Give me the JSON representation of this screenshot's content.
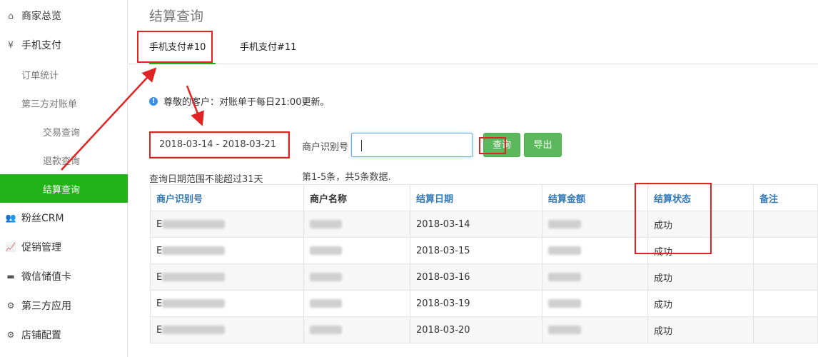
{
  "sidebar": {
    "items": [
      {
        "icon": "home-icon",
        "glyph": "⌂",
        "label": "商家总览"
      },
      {
        "icon": "yuan-icon",
        "glyph": "¥",
        "label": "手机支付"
      },
      {
        "label": "订单统计"
      },
      {
        "label": "第三方对账单"
      },
      {
        "label": "交易查询"
      },
      {
        "label": "退款查询"
      },
      {
        "label": "结算查询"
      },
      {
        "icon": "users-icon",
        "glyph": "👥",
        "label": "粉丝CRM"
      },
      {
        "icon": "chart-icon",
        "glyph": "📈",
        "label": "促销管理"
      },
      {
        "icon": "card-icon",
        "glyph": "▬",
        "label": "微信储值卡"
      },
      {
        "icon": "apps-icon",
        "glyph": "⚙",
        "label": "第三方应用"
      },
      {
        "icon": "settings-icon",
        "glyph": "⚙",
        "label": "店铺配置"
      }
    ]
  },
  "page": {
    "title": "结算查询",
    "tabs": [
      {
        "label": "手机支付#10"
      },
      {
        "label": "手机支付#11"
      }
    ],
    "notice": "尊敬的客户：对账单于每日21:00更新。",
    "date_range": "2018-03-14 - 2018-03-21",
    "merchant_label": "商户识别号",
    "merchant_value": "",
    "query_button": "查询",
    "export_button": "导出",
    "range_hint": "查询日期范围不能超过31天",
    "count_info": "第1-5条，共5条数据."
  },
  "table": {
    "headers": [
      "商户识别号",
      "商户名称",
      "结算日期",
      "结算金额",
      "结算状态",
      "备注"
    ],
    "rows": [
      {
        "id_prefix": "E",
        "date": "2018-03-14",
        "status": "成功"
      },
      {
        "id_prefix": "E",
        "date": "2018-03-15",
        "status": "成功"
      },
      {
        "id_prefix": "E",
        "date": "2018-03-16",
        "status": "成功"
      },
      {
        "id_prefix": "E",
        "date": "2018-03-19",
        "status": "成功"
      },
      {
        "id_prefix": "E",
        "date": "2018-03-20",
        "status": "成功"
      }
    ]
  },
  "colors": {
    "accent": "#22b318",
    "link": "#337ab7",
    "annotation": "#e02424"
  }
}
